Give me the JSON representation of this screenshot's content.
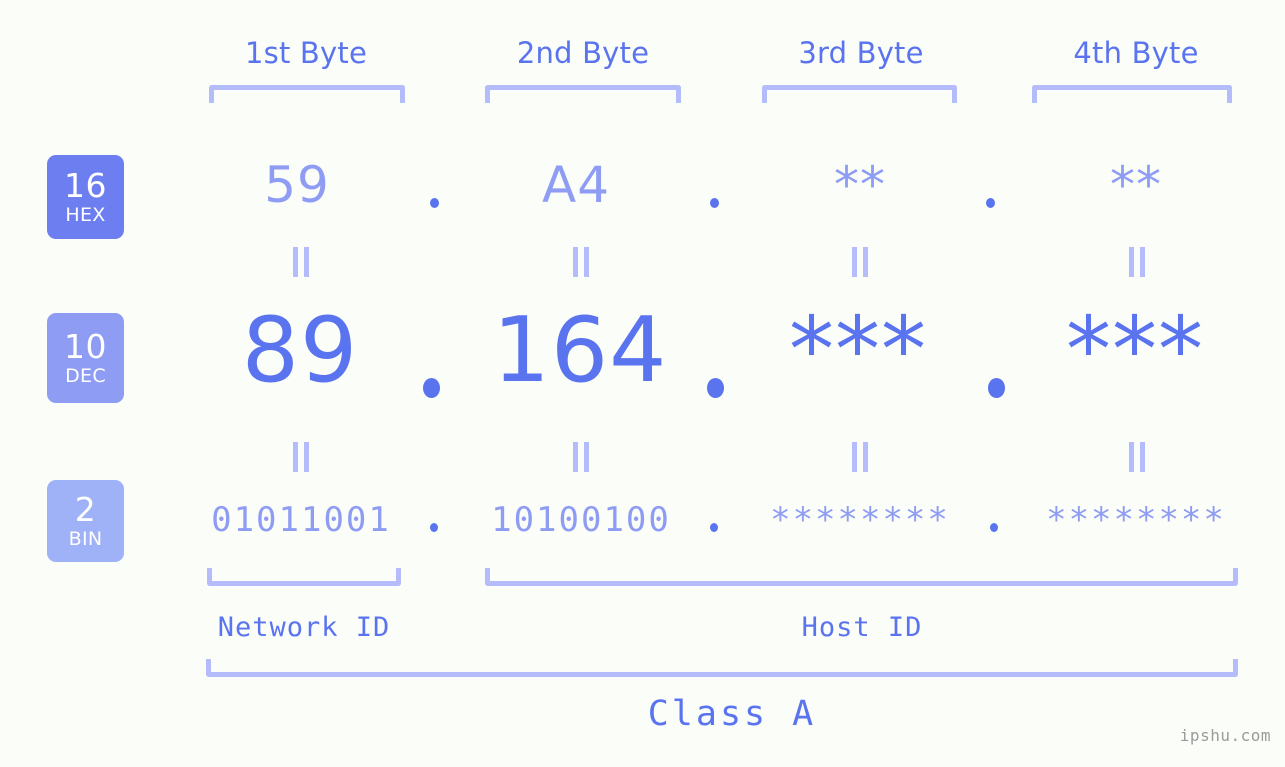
{
  "meta": {
    "watermark": "ipshu.com",
    "background": "#fbfdf9",
    "accent_strong": "#5a73ee",
    "accent_mid": "#8e9cf4",
    "accent_light": "#b4bcfb"
  },
  "byte_headers": [
    {
      "label": "1st Byte"
    },
    {
      "label": "2nd Byte"
    },
    {
      "label": "3rd Byte"
    },
    {
      "label": "4th Byte"
    }
  ],
  "radix_badges": [
    {
      "number": "16",
      "system": "HEX",
      "color": "#6d7ef0"
    },
    {
      "number": "10",
      "system": "DEC",
      "color": "#8e9cf4"
    },
    {
      "number": "2",
      "system": "BIN",
      "color": "#9fb1f7"
    }
  ],
  "rows": {
    "hex": {
      "values": [
        "59",
        "A4",
        "**",
        "**"
      ],
      "separator": "."
    },
    "dec": {
      "values": [
        "89",
        "164",
        "***",
        "***"
      ],
      "separator": "."
    },
    "bin": {
      "values": [
        "01011001",
        "10100100",
        "********",
        "********"
      ],
      "separator": "."
    }
  },
  "equals_symbol": "||",
  "segments": {
    "network_id": "Network ID",
    "host_id": "Host ID"
  },
  "class": {
    "label": "Class A"
  }
}
